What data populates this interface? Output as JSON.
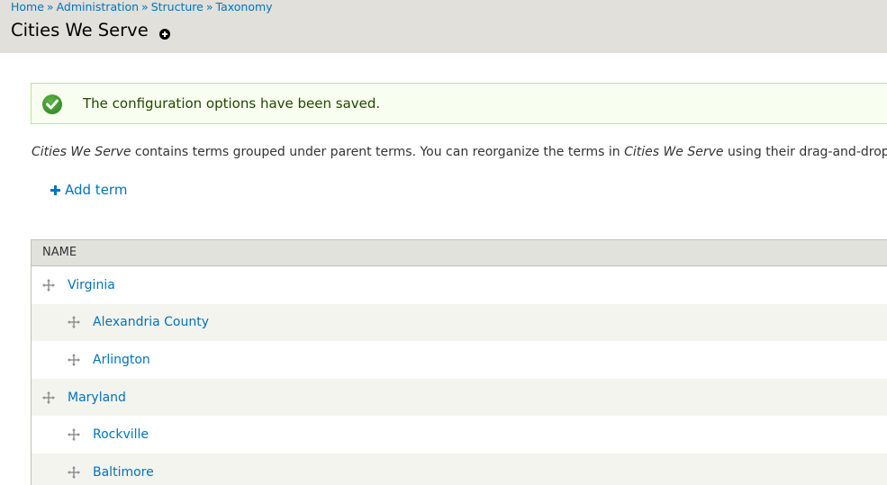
{
  "breadcrumb": {
    "items": [
      "Home",
      "Administration",
      "Structure",
      "Taxonomy"
    ],
    "separator": "»"
  },
  "page": {
    "title": "Cities We Serve",
    "shortcut_icon": "add-shortcut-icon"
  },
  "message": {
    "type": "status",
    "icon": "check-circle-icon",
    "text": "The configuration options have been saved."
  },
  "description": {
    "vocab": "Cities We Serve",
    "part1": " contains terms grouped under parent terms. You can reorganize the terms in ",
    "part2": " using their drag-and-drop handles."
  },
  "actions": {
    "add_term": "Add term"
  },
  "table": {
    "header": "Name",
    "rows": [
      {
        "name": "Virginia",
        "depth": 0
      },
      {
        "name": "Alexandria County",
        "depth": 1
      },
      {
        "name": "Arlington",
        "depth": 1
      },
      {
        "name": "Maryland",
        "depth": 0
      },
      {
        "name": "Rockville",
        "depth": 1
      },
      {
        "name": "Baltimore",
        "depth": 1
      }
    ]
  },
  "colors": {
    "link": "#0074bd",
    "header_bg": "#e1e0da",
    "status_bg": "#f8fff0",
    "status_border": "#bee58e",
    "row_alt": "#f3f4ee"
  }
}
